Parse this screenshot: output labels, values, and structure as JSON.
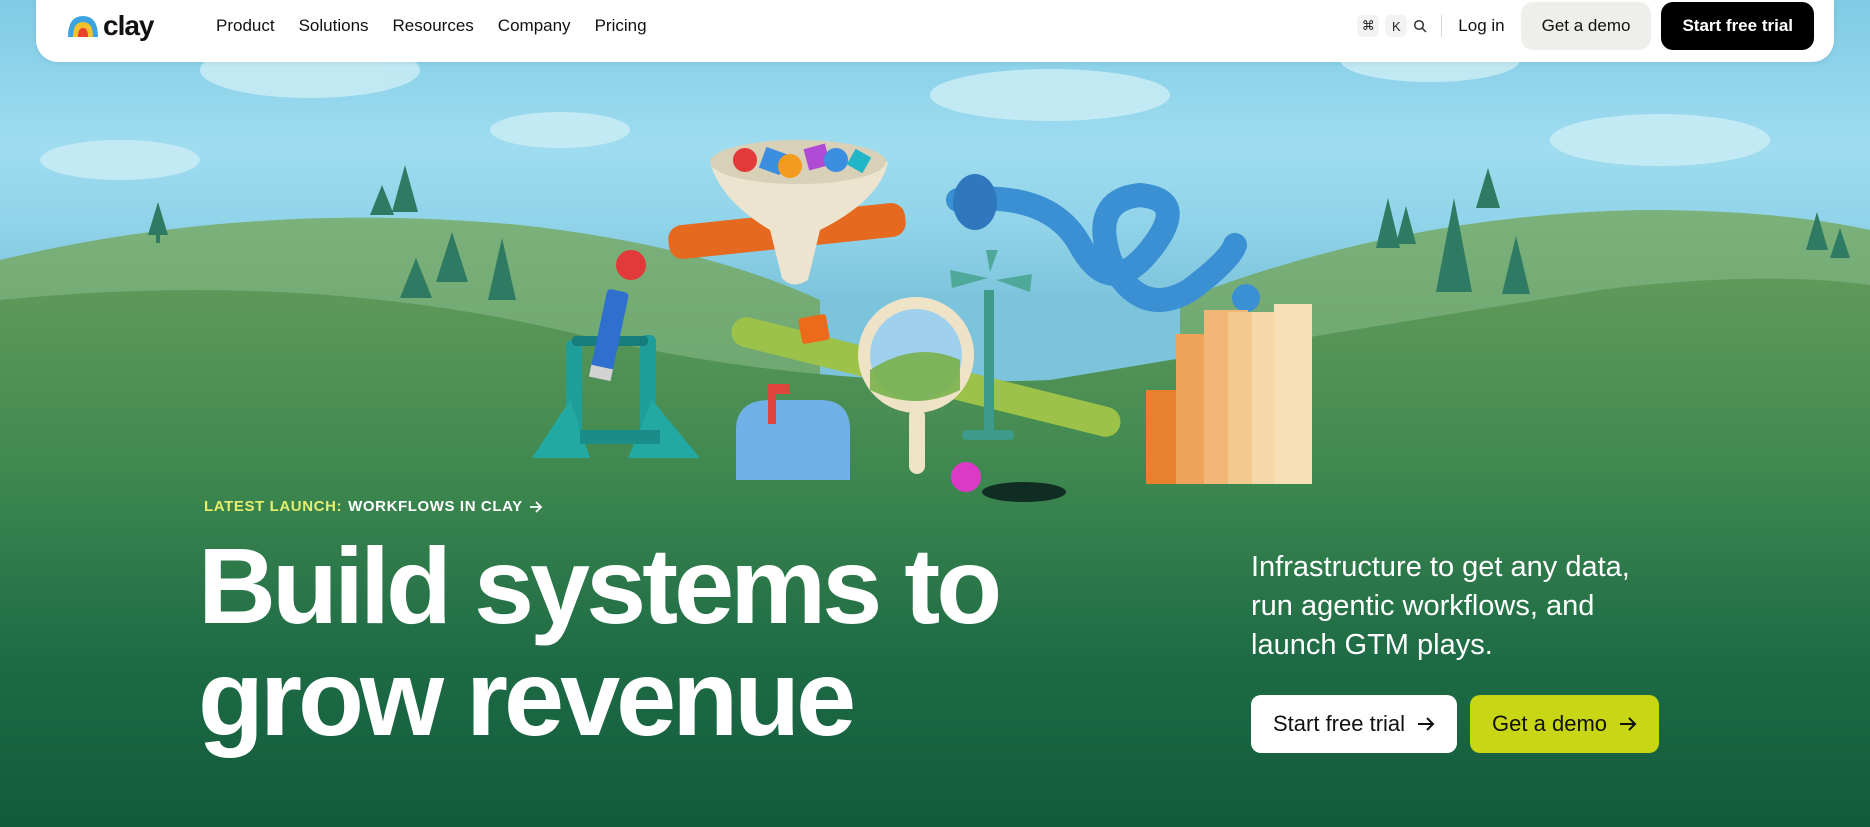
{
  "nav": {
    "logo_text": "clay",
    "links": [
      "Product",
      "Solutions",
      "Resources",
      "Company",
      "Pricing"
    ],
    "shortcut_cmd": "⌘",
    "shortcut_key": "K",
    "login": "Log in",
    "demo": "Get a demo",
    "trial": "Start free trial"
  },
  "hero": {
    "launch_prefix": "LATEST LAUNCH:",
    "launch_text": "WORKFLOWS IN CLAY",
    "headline_line1": "Build systems to",
    "headline_line2": "grow revenue",
    "subheadline": "Infrastructure to get any data, run agentic workflows, and launch GTM plays.",
    "cta_trial": "Start free trial",
    "cta_demo": "Get a demo"
  },
  "icons": {
    "logo": "rainbow-arch-icon",
    "search": "search-icon",
    "arrow": "arrow-right-icon"
  },
  "colors": {
    "accent_lime": "#c8d616",
    "launch_yellow": "#e7ef6e",
    "hero_green": "#145c3e",
    "nav_cta_black": "#000000"
  }
}
